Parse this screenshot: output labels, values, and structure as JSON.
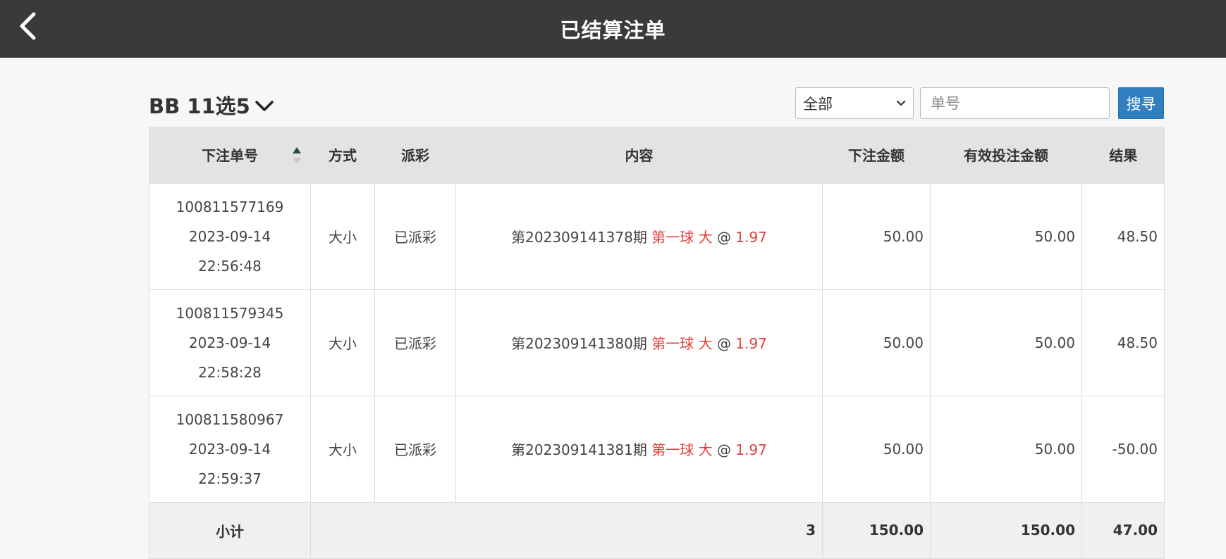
{
  "header": {
    "title": "已结算注单",
    "back_icon": "chevron-left-icon"
  },
  "toolbar": {
    "game_name": "BB 11选5",
    "filter": {
      "selected": "全部"
    },
    "order_input": {
      "value": "",
      "placeholder": "单号"
    },
    "search_label": "搜寻"
  },
  "table": {
    "columns": [
      "下注单号",
      "方式",
      "派彩",
      "内容",
      "下注金额",
      "有效投注金额",
      "结果"
    ],
    "rows": [
      {
        "order_no": "100811577169",
        "date": "2023-09-14",
        "time": "22:56:48",
        "method": "大小",
        "payout": "已派彩",
        "period": "第202309141378期",
        "bet": "第一球 大",
        "at": "@",
        "odds": "1.97",
        "amount": "50.00",
        "valid_amount": "50.00",
        "result": "48.50",
        "result_negative": false
      },
      {
        "order_no": "100811579345",
        "date": "2023-09-14",
        "time": "22:58:28",
        "method": "大小",
        "payout": "已派彩",
        "period": "第202309141380期",
        "bet": "第一球 大",
        "at": "@",
        "odds": "1.97",
        "amount": "50.00",
        "valid_amount": "50.00",
        "result": "48.50",
        "result_negative": false
      },
      {
        "order_no": "100811580967",
        "date": "2023-09-14",
        "time": "22:59:37",
        "method": "大小",
        "payout": "已派彩",
        "period": "第202309141381期",
        "bet": "第一球 大",
        "at": "@",
        "odds": "1.97",
        "amount": "50.00",
        "valid_amount": "50.00",
        "result": "-50.00",
        "result_negative": true
      }
    ],
    "subtotal": {
      "label": "小计",
      "count": "3",
      "amount": "150.00",
      "valid_amount": "150.00",
      "result": "47.00"
    }
  },
  "colors": {
    "header_bg": "#3a3a3a",
    "accent_red": "#e0413a",
    "search_blue": "#2f7fc1"
  }
}
